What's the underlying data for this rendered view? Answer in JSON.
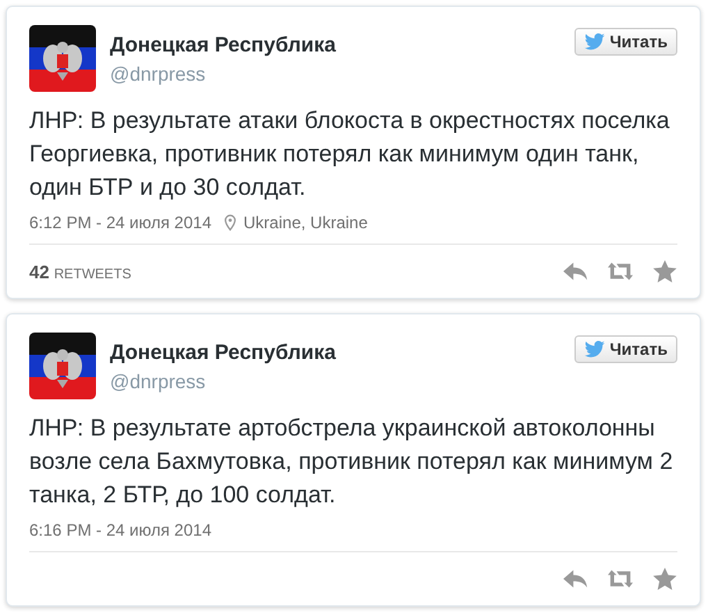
{
  "tweets": [
    {
      "author": "Донецкая Республика",
      "handle": "@dnrpress",
      "follow_button": "Читать",
      "text": "ЛНР: В результате атаки блокоста в окрестностях поселка Георгиевка, противник потерял как минимум один танк, один БТР и до 30 солдат.",
      "timestamp": "6:12 PM - 24 июля 2014",
      "location": "Ukraine, Ukraine",
      "retweets": {
        "count": "42",
        "label": "RETWEETS"
      }
    },
    {
      "author": "Донецкая Республика",
      "handle": "@dnrpress",
      "follow_button": "Читать",
      "text": "ЛНР: В результате артобстрела украинской автоколонны возле села Бахмутовка, противник потерял как минимум 2 танка, 2 БТР, до 100 солдат.",
      "timestamp": "6:16 PM - 24 июля 2014"
    }
  ]
}
